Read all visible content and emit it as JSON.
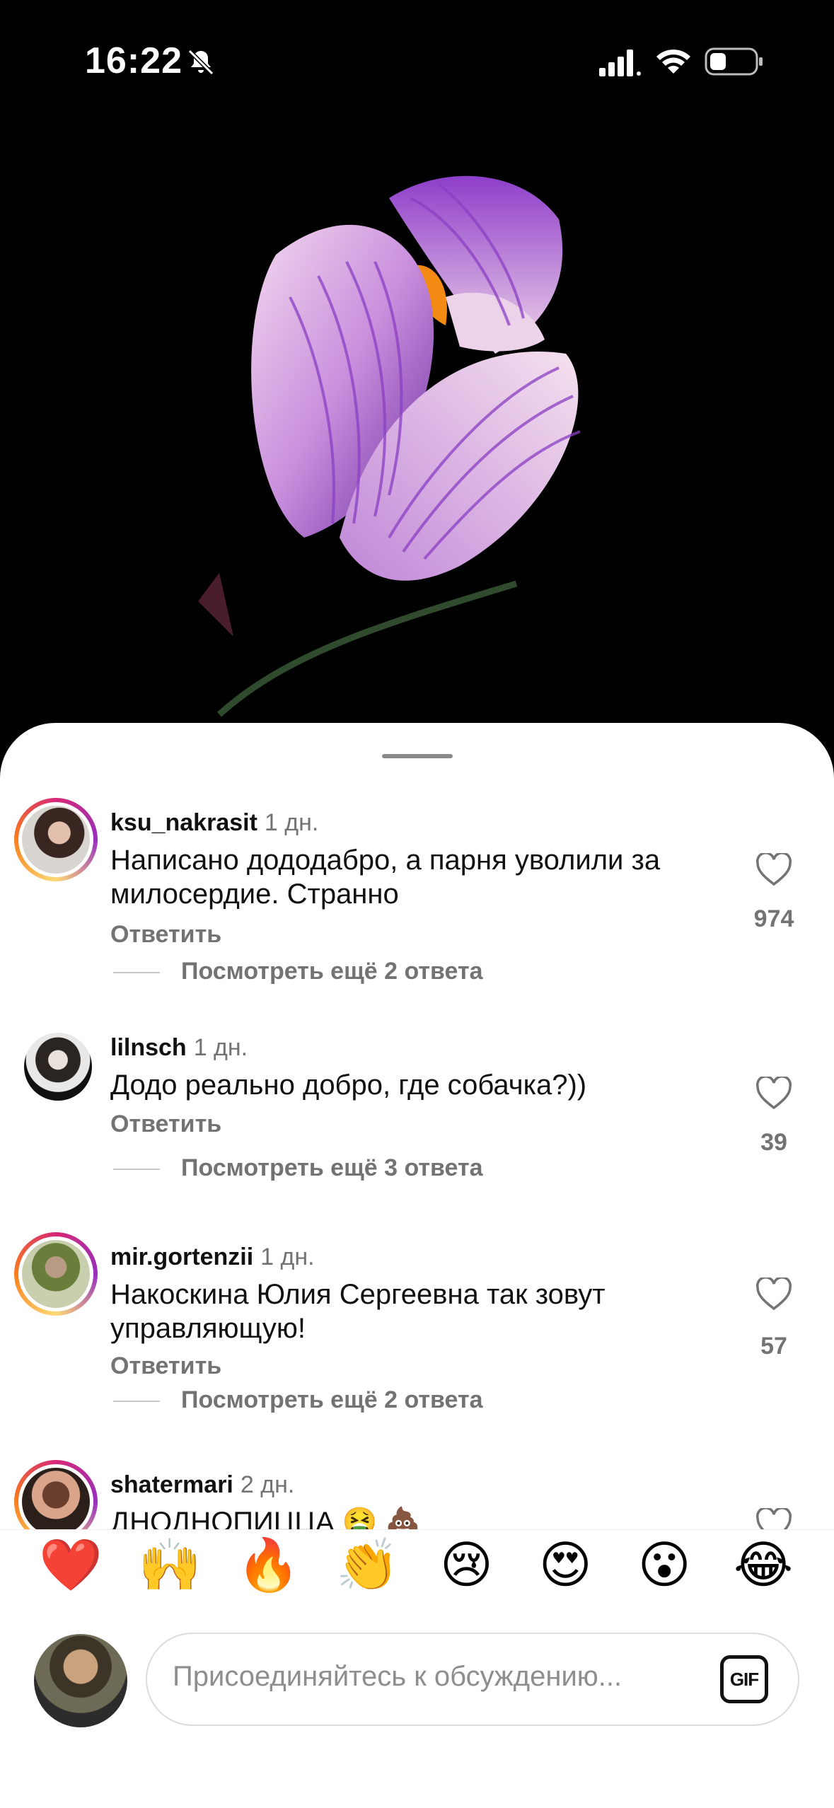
{
  "status_bar": {
    "time": "16:22"
  },
  "comments": [
    {
      "username": "ksu_nakrasit",
      "time": "1 дн.",
      "text": "Написано дододабро, а парня уволили за милосердие. Странно",
      "reply_label": "Ответить",
      "more_replies": "Посмотреть ещё 2 ответа",
      "likes": "974",
      "story_ring": true
    },
    {
      "username": "lilnsch",
      "time": "1 дн.",
      "text": "Додо реально добро, где собачка?))",
      "reply_label": "Ответить",
      "more_replies": "Посмотреть ещё 3 ответа",
      "likes": "39",
      "story_ring": false
    },
    {
      "username": "mir.gortenzii",
      "time": "1 дн.",
      "text": "Накоскина Юлия Сергеевна так зовут управляющую!",
      "reply_label": "Ответить",
      "more_replies": "Посмотреть ещё 2 ответа",
      "likes": "57",
      "story_ring": true
    },
    {
      "username": "shatermari",
      "time": "2 дн.",
      "text": "ДНОДНОПИЦЦА 🤮 💩",
      "story_ring": true
    }
  ],
  "emoji_bar": [
    "❤️",
    "🙌",
    "🔥",
    "👏",
    "😢",
    "😍",
    "😮",
    "😂"
  ],
  "composer": {
    "placeholder": "Присоединяйтесь к обсуждению...",
    "gif_label": "GIF"
  },
  "colors": {
    "accent_ring_start": "#d62976",
    "secondary_text": "#737373",
    "flower_purple": "#8e3ec9"
  }
}
